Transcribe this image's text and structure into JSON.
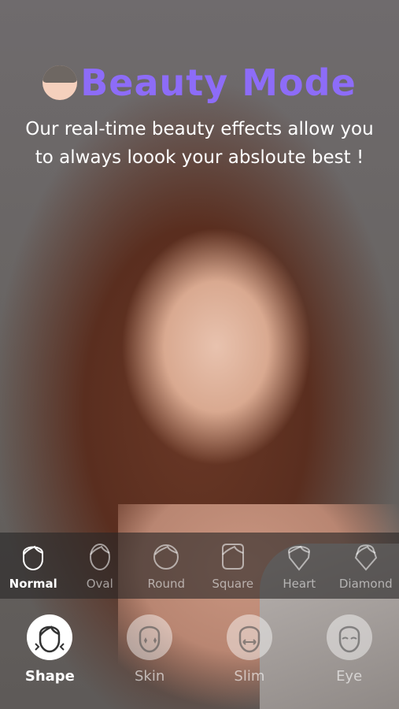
{
  "header": {
    "title": "Beauty Mode",
    "subtitle_line1": "Our real-time beauty effects allow you",
    "subtitle_line2": "to always loook your absloute best !"
  },
  "face_shapes": {
    "selected": "Normal",
    "items": [
      {
        "label": "Normal",
        "icon": "face-normal-icon"
      },
      {
        "label": "Oval",
        "icon": "face-oval-icon"
      },
      {
        "label": "Round",
        "icon": "face-round-icon"
      },
      {
        "label": "Square",
        "icon": "face-square-icon"
      },
      {
        "label": "Heart",
        "icon": "face-heart-icon"
      },
      {
        "label": "Diamond",
        "icon": "face-diamond-icon"
      }
    ]
  },
  "tabs": {
    "selected": "Shape",
    "items": [
      {
        "label": "Shape",
        "icon": "shape-tab-icon"
      },
      {
        "label": "Skin",
        "icon": "skin-tab-icon"
      },
      {
        "label": "Slim",
        "icon": "slim-tab-icon"
      },
      {
        "label": "Eye",
        "icon": "eye-tab-icon"
      }
    ]
  },
  "colors": {
    "accent": "#8d6cf8",
    "text": "#ffffff"
  }
}
